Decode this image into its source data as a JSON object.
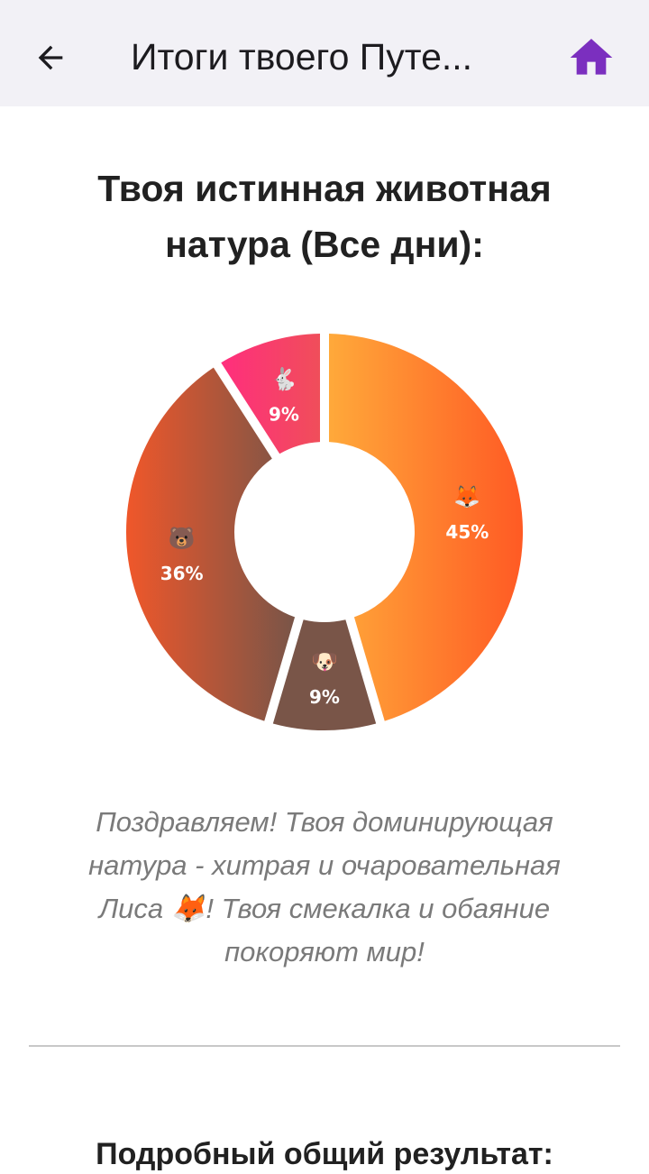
{
  "appbar": {
    "title": "Итоги твоего Путе...",
    "back_icon": "arrow-left-icon",
    "home_icon": "home-icon",
    "home_color": "#7b2fbf"
  },
  "heading": "Твоя истинная животная натура (Все дни):",
  "chart_data": {
    "type": "pie",
    "variant": "donut",
    "title": "",
    "slices": [
      {
        "emoji": "🦊",
        "label": "45%",
        "value": 45,
        "colors": [
          "#ffa93a",
          "#ff5a24"
        ]
      },
      {
        "emoji": "🐶",
        "label": "9%",
        "value": 9,
        "colors": [
          "#795548",
          "#795548"
        ]
      },
      {
        "emoji": "🐻",
        "label": "36%",
        "value": 36,
        "colors": [
          "#f0572a",
          "#795548"
        ]
      },
      {
        "emoji": "🐇",
        "label": "9%",
        "value": 9,
        "colors": [
          "#ff2e7d",
          "#f04e5a"
        ]
      }
    ]
  },
  "message": "Поздравляем! Твоя доминирующая натура - хитрая и очаровательная Лиса 🦊! Твоя смекалка и обаяние покоряют мир!",
  "subheading": "Подробный общий результат:"
}
